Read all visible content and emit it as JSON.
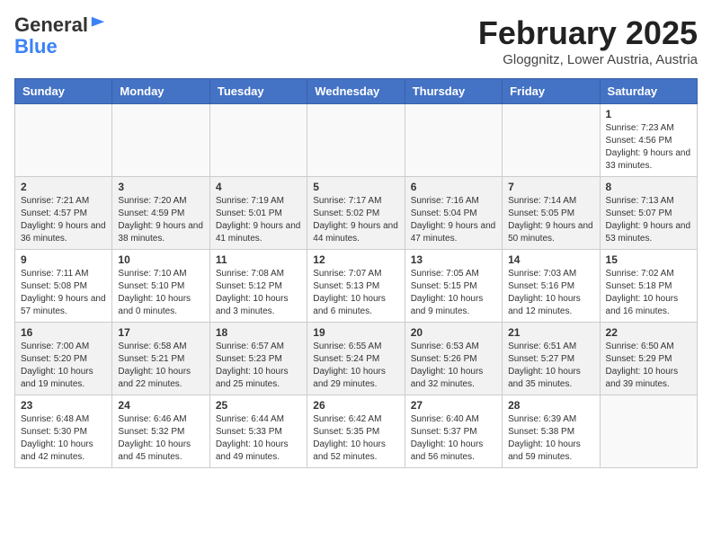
{
  "logo": {
    "general": "General",
    "blue": "Blue"
  },
  "header": {
    "month": "February 2025",
    "location": "Gloggnitz, Lower Austria, Austria"
  },
  "weekdays": [
    "Sunday",
    "Monday",
    "Tuesday",
    "Wednesday",
    "Thursday",
    "Friday",
    "Saturday"
  ],
  "weeks": [
    [
      {
        "day": "",
        "info": ""
      },
      {
        "day": "",
        "info": ""
      },
      {
        "day": "",
        "info": ""
      },
      {
        "day": "",
        "info": ""
      },
      {
        "day": "",
        "info": ""
      },
      {
        "day": "",
        "info": ""
      },
      {
        "day": "1",
        "info": "Sunrise: 7:23 AM\nSunset: 4:56 PM\nDaylight: 9 hours and 33 minutes."
      }
    ],
    [
      {
        "day": "2",
        "info": "Sunrise: 7:21 AM\nSunset: 4:57 PM\nDaylight: 9 hours and 36 minutes."
      },
      {
        "day": "3",
        "info": "Sunrise: 7:20 AM\nSunset: 4:59 PM\nDaylight: 9 hours and 38 minutes."
      },
      {
        "day": "4",
        "info": "Sunrise: 7:19 AM\nSunset: 5:01 PM\nDaylight: 9 hours and 41 minutes."
      },
      {
        "day": "5",
        "info": "Sunrise: 7:17 AM\nSunset: 5:02 PM\nDaylight: 9 hours and 44 minutes."
      },
      {
        "day": "6",
        "info": "Sunrise: 7:16 AM\nSunset: 5:04 PM\nDaylight: 9 hours and 47 minutes."
      },
      {
        "day": "7",
        "info": "Sunrise: 7:14 AM\nSunset: 5:05 PM\nDaylight: 9 hours and 50 minutes."
      },
      {
        "day": "8",
        "info": "Sunrise: 7:13 AM\nSunset: 5:07 PM\nDaylight: 9 hours and 53 minutes."
      }
    ],
    [
      {
        "day": "9",
        "info": "Sunrise: 7:11 AM\nSunset: 5:08 PM\nDaylight: 9 hours and 57 minutes."
      },
      {
        "day": "10",
        "info": "Sunrise: 7:10 AM\nSunset: 5:10 PM\nDaylight: 10 hours and 0 minutes."
      },
      {
        "day": "11",
        "info": "Sunrise: 7:08 AM\nSunset: 5:12 PM\nDaylight: 10 hours and 3 minutes."
      },
      {
        "day": "12",
        "info": "Sunrise: 7:07 AM\nSunset: 5:13 PM\nDaylight: 10 hours and 6 minutes."
      },
      {
        "day": "13",
        "info": "Sunrise: 7:05 AM\nSunset: 5:15 PM\nDaylight: 10 hours and 9 minutes."
      },
      {
        "day": "14",
        "info": "Sunrise: 7:03 AM\nSunset: 5:16 PM\nDaylight: 10 hours and 12 minutes."
      },
      {
        "day": "15",
        "info": "Sunrise: 7:02 AM\nSunset: 5:18 PM\nDaylight: 10 hours and 16 minutes."
      }
    ],
    [
      {
        "day": "16",
        "info": "Sunrise: 7:00 AM\nSunset: 5:20 PM\nDaylight: 10 hours and 19 minutes."
      },
      {
        "day": "17",
        "info": "Sunrise: 6:58 AM\nSunset: 5:21 PM\nDaylight: 10 hours and 22 minutes."
      },
      {
        "day": "18",
        "info": "Sunrise: 6:57 AM\nSunset: 5:23 PM\nDaylight: 10 hours and 25 minutes."
      },
      {
        "day": "19",
        "info": "Sunrise: 6:55 AM\nSunset: 5:24 PM\nDaylight: 10 hours and 29 minutes."
      },
      {
        "day": "20",
        "info": "Sunrise: 6:53 AM\nSunset: 5:26 PM\nDaylight: 10 hours and 32 minutes."
      },
      {
        "day": "21",
        "info": "Sunrise: 6:51 AM\nSunset: 5:27 PM\nDaylight: 10 hours and 35 minutes."
      },
      {
        "day": "22",
        "info": "Sunrise: 6:50 AM\nSunset: 5:29 PM\nDaylight: 10 hours and 39 minutes."
      }
    ],
    [
      {
        "day": "23",
        "info": "Sunrise: 6:48 AM\nSunset: 5:30 PM\nDaylight: 10 hours and 42 minutes."
      },
      {
        "day": "24",
        "info": "Sunrise: 6:46 AM\nSunset: 5:32 PM\nDaylight: 10 hours and 45 minutes."
      },
      {
        "day": "25",
        "info": "Sunrise: 6:44 AM\nSunset: 5:33 PM\nDaylight: 10 hours and 49 minutes."
      },
      {
        "day": "26",
        "info": "Sunrise: 6:42 AM\nSunset: 5:35 PM\nDaylight: 10 hours and 52 minutes."
      },
      {
        "day": "27",
        "info": "Sunrise: 6:40 AM\nSunset: 5:37 PM\nDaylight: 10 hours and 56 minutes."
      },
      {
        "day": "28",
        "info": "Sunrise: 6:39 AM\nSunset: 5:38 PM\nDaylight: 10 hours and 59 minutes."
      },
      {
        "day": "",
        "info": ""
      }
    ]
  ]
}
